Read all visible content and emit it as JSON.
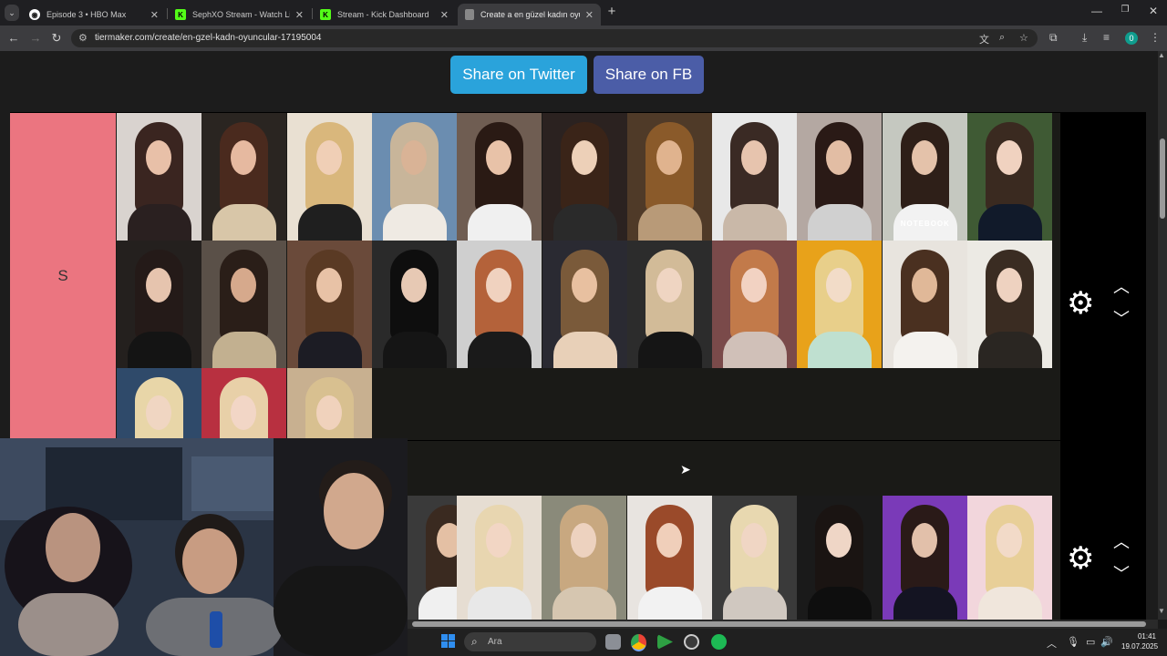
{
  "browser": {
    "tabs": [
      {
        "title": "Episode 3 • HBO Max",
        "active": false
      },
      {
        "title": "SephXO Stream - Watch Live on",
        "active": false
      },
      {
        "title": "Stream - Kick Dashboard",
        "active": false
      },
      {
        "title": "Create a en güzel kadın oyuncu",
        "active": true
      }
    ],
    "new_tab_icon": "plus-icon",
    "url": "tiermaker.com/create/en-gzel-kadn-oyuncular-17195004"
  },
  "page": {
    "share_twitter": "Share on Twitter",
    "share_fb": "Share on FB",
    "tier_s_label": "S",
    "tier_s_tile_count": 25,
    "tier_2_label": "",
    "tier_2_tile_count": 8,
    "tile_caption": "NOTEBOOK"
  },
  "taskbar": {
    "search_placeholder": "Ara",
    "time": "01:41",
    "date": "19.07.2025"
  },
  "colors": {
    "tier_s": "#eb7580",
    "twitter": "#2aa3db",
    "facebook": "#4b5da7",
    "side_panel": "#000000"
  }
}
